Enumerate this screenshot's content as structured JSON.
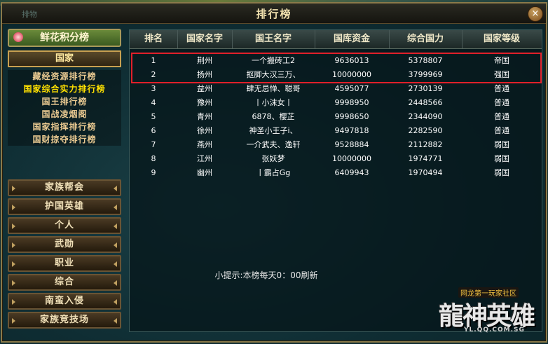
{
  "window": {
    "title": "排行榜",
    "ghost_label": "排物",
    "close_symbol": "×"
  },
  "left_nav": {
    "top_button": "鲜花积分榜",
    "country_button": "国家",
    "sub_items": [
      {
        "label": "藏经资源排行榜",
        "active": false
      },
      {
        "label": "国家综合实力排行榜",
        "active": true
      },
      {
        "label": "国王排行榜",
        "active": false
      },
      {
        "label": "国战凌烟阁",
        "active": false
      },
      {
        "label": "国家指挥排行榜",
        "active": false
      },
      {
        "label": "国财掠夺排行榜",
        "active": false
      }
    ],
    "buttons": [
      "家族帮会",
      "护国英雄",
      "个人",
      "武勋",
      "职业",
      "综合",
      "南蛮入侵",
      "家族竞技场"
    ]
  },
  "table": {
    "headers": [
      "排名",
      "国家名字",
      "国王名字",
      "国库资金",
      "综合国力",
      "国家等级"
    ],
    "rows": [
      [
        "1",
        "荆州",
        "一个搬砖工2",
        "9636013",
        "5378807",
        "帝国"
      ],
      [
        "2",
        "扬州",
        "抠脚大汉三万、",
        "10000000",
        "3799969",
        "强国"
      ],
      [
        "3",
        "益州",
        "肆无忌惮、聪哥",
        "4595077",
        "2730139",
        "普通"
      ],
      [
        "4",
        "豫州",
        "丨小沫女丨",
        "9998950",
        "2448566",
        "普通"
      ],
      [
        "5",
        "青州",
        "6878、樱芷",
        "9998650",
        "2344090",
        "普通"
      ],
      [
        "6",
        "徐州",
        "神圣小王子i、",
        "9497818",
        "2282590",
        "普通"
      ],
      [
        "7",
        "燕州",
        "一介武夫、逸轩",
        "9528884",
        "2112882",
        "弱国"
      ],
      [
        "8",
        "江州",
        "张妖梦",
        "10000000",
        "1974771",
        "弱国"
      ],
      [
        "9",
        "幽州",
        "丨霸占Gg",
        "6409943",
        "1970494",
        "弱国"
      ]
    ]
  },
  "hint": "小提示:本榜每天0：00刷新",
  "logo": {
    "slogan": "网龙第一玩家社区",
    "brand": "龍神英雄",
    "url": "YL.QQ.COM.SG"
  },
  "colors": {
    "highlight_border": "#e0202a",
    "active_sub_item": "#ffe000",
    "frame_gold": "#8a7a4a"
  }
}
